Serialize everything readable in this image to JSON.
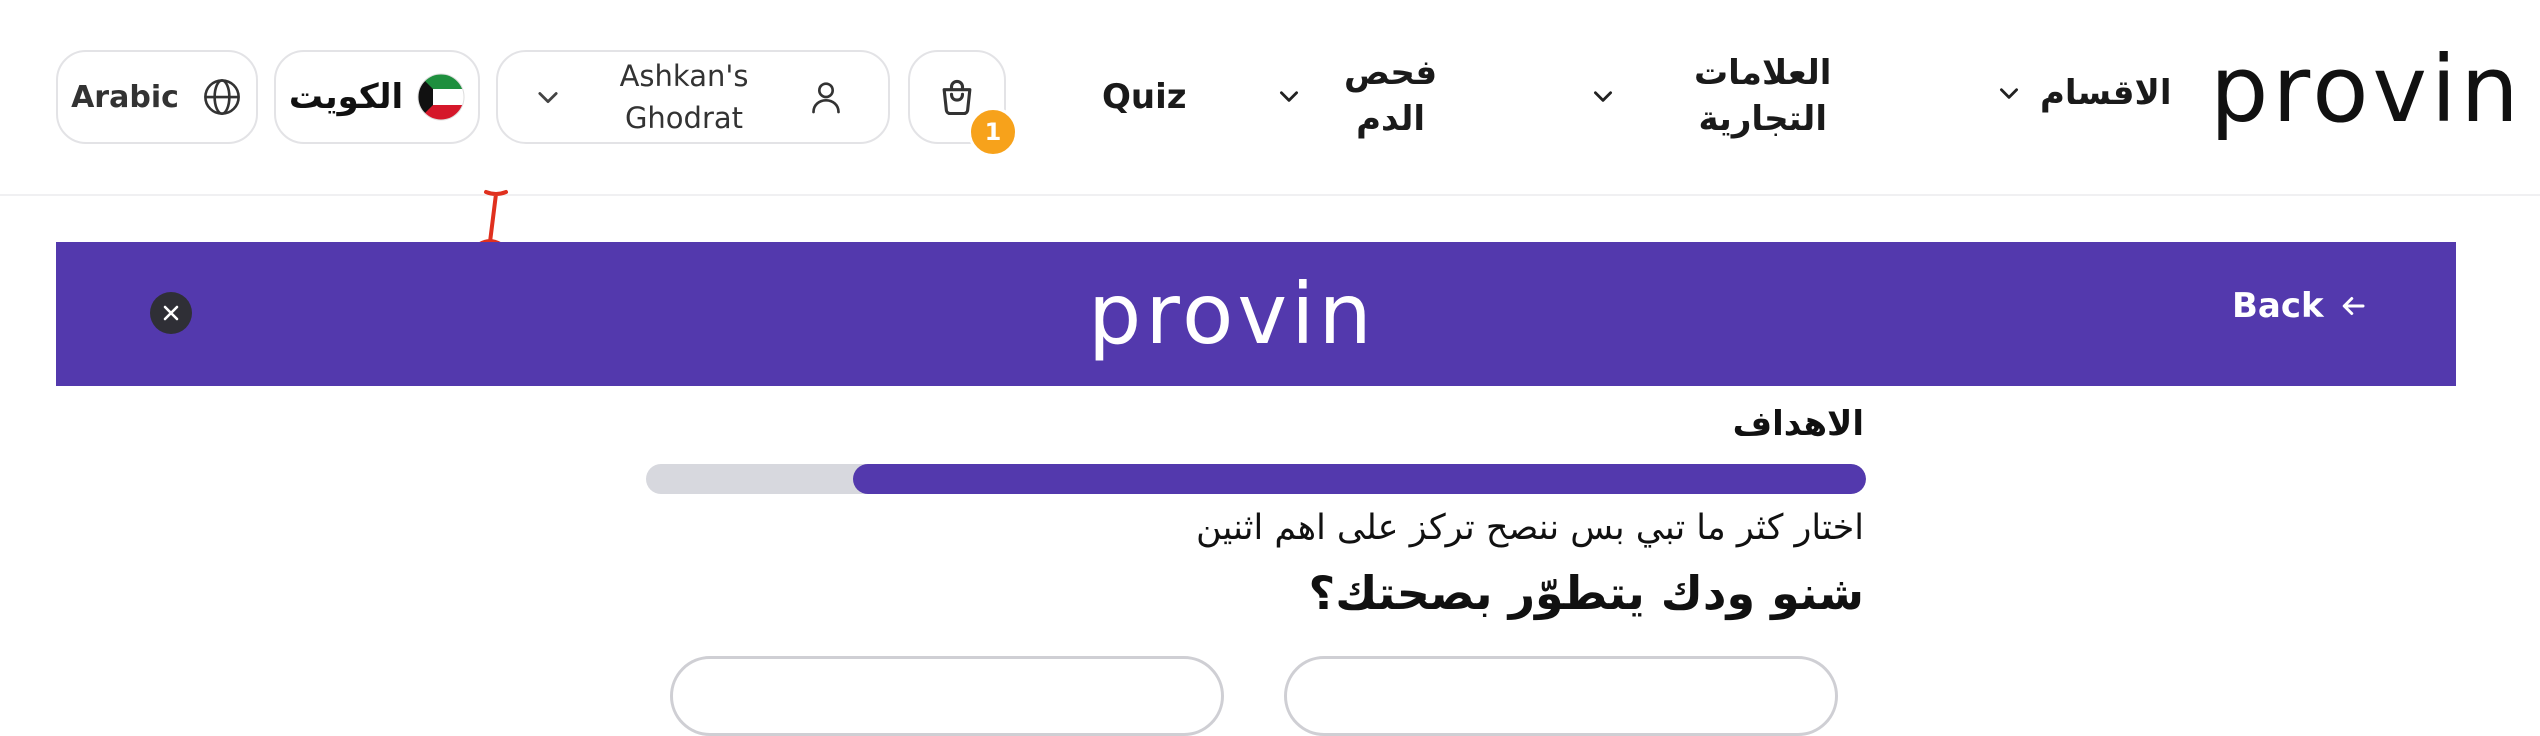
{
  "header": {
    "logo": "provin",
    "nav": {
      "categories": "الاقسام",
      "brands_line1": "العلامات",
      "brands_line2": "التجارية",
      "blood_test_line1": "فحص",
      "blood_test_line2": "الدم",
      "quiz": "Quiz"
    },
    "cart_count": "1",
    "user": {
      "name_line1": "Ashkan's",
      "name_line2": "Ghodrat"
    },
    "country": "الكويت",
    "language": "Arabic"
  },
  "banner": {
    "logo": "provin",
    "back_label": "Back"
  },
  "quiz": {
    "step_title": "الاهداف",
    "progress_percent": 83,
    "instruction": "اختار كثر ما تبي بس ننصح تركز على اهم اثنين",
    "question": "شنو ودك يتطوّر بصحتك؟"
  },
  "colors": {
    "brand_purple": "#5339ad",
    "badge_orange": "#f7a21b",
    "progress_track": "#d7d8de"
  }
}
